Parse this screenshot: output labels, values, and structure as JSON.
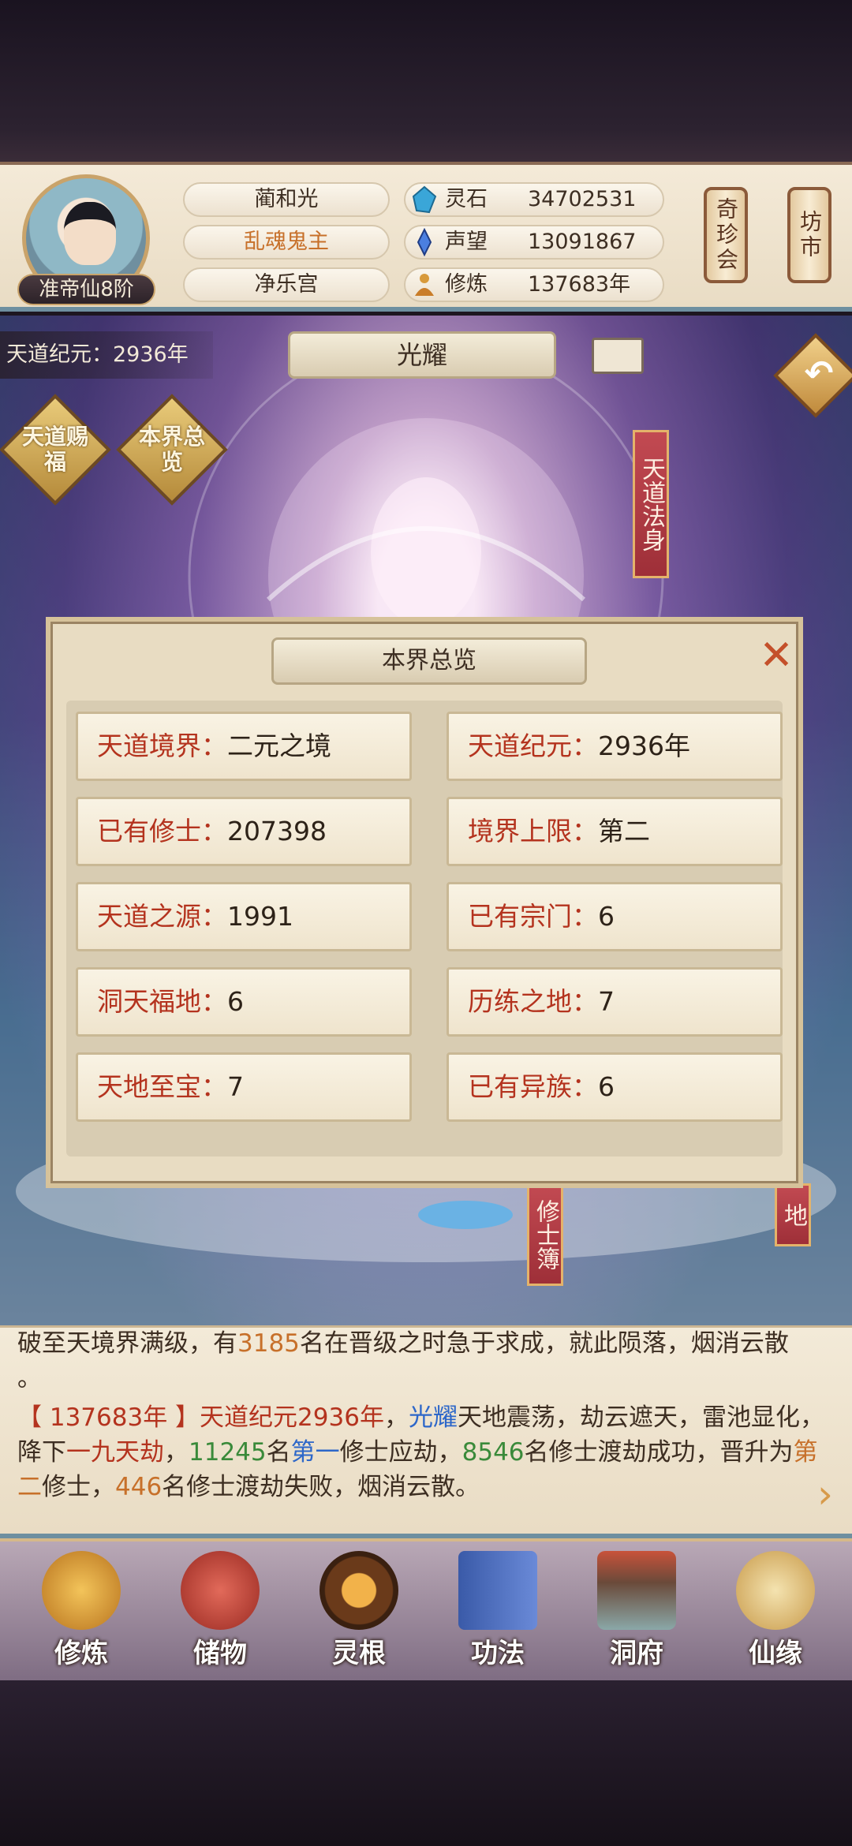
{
  "header": {
    "rank": "准帝仙8阶",
    "names": [
      "蔺和光",
      "乱魂鬼主",
      "净乐宫"
    ],
    "resources": [
      {
        "icon": "spirit-stone-icon",
        "label": "灵石",
        "value": "34702531"
      },
      {
        "icon": "prestige-icon",
        "label": "声望",
        "value": "13091867"
      },
      {
        "icon": "cultivation-icon",
        "label": "修炼",
        "value": "137683年"
      }
    ],
    "side_buttons": [
      "奇珍会",
      "坊市"
    ]
  },
  "scene": {
    "era": "天道纪元：2936年",
    "title": "光耀",
    "left_buttons": [
      "天道赐福",
      "本界总览"
    ],
    "right_banner": "天道法身",
    "bottom_banner_mid": "修士簿",
    "bottom_banner_right": "地"
  },
  "modal": {
    "title": "本界总览",
    "cells": [
      {
        "key": "天道境界：",
        "value": "二元之境"
      },
      {
        "key": "天道纪元：",
        "value": "2936年"
      },
      {
        "key": "已有修士：",
        "value": "207398"
      },
      {
        "key": "境界上限：",
        "value": "第二"
      },
      {
        "key": "天道之源：",
        "value": "1991"
      },
      {
        "key": "已有宗门：",
        "value": "6"
      },
      {
        "key": "洞天福地：",
        "value": "6"
      },
      {
        "key": "历练之地：",
        "value": "7"
      },
      {
        "key": "天地至宝：",
        "value": "7"
      },
      {
        "key": "已有异族：",
        "value": "6"
      }
    ]
  },
  "log": {
    "line1_a": "破至天境界满级，有",
    "line1_num": "3185",
    "line1_b": "名在晋级之时急于求成，就此陨落，烟消云散",
    "line1_end": "。",
    "entry_time": "【 137683年 】",
    "entry_era": "天道纪元2936年",
    "entry_name": "光耀",
    "entry_t1": "天地震荡，劫云遮天，雷池显化，降下",
    "entry_calamity": "一九天劫",
    "entry_t2": "，",
    "entry_num1": "11245",
    "entry_t3": "名",
    "entry_rank1": "第一",
    "entry_t4": "修士应劫，",
    "entry_num2": "8546",
    "entry_t5": "名修士渡劫成功，晋升为",
    "entry_rank2": "第二",
    "entry_t6": "修士，",
    "entry_num3": "446",
    "entry_t7": "名修士渡劫失败，烟消云散。"
  },
  "nav": [
    "修炼",
    "储物",
    "灵根",
    "功法",
    "洞府",
    "仙缘"
  ]
}
